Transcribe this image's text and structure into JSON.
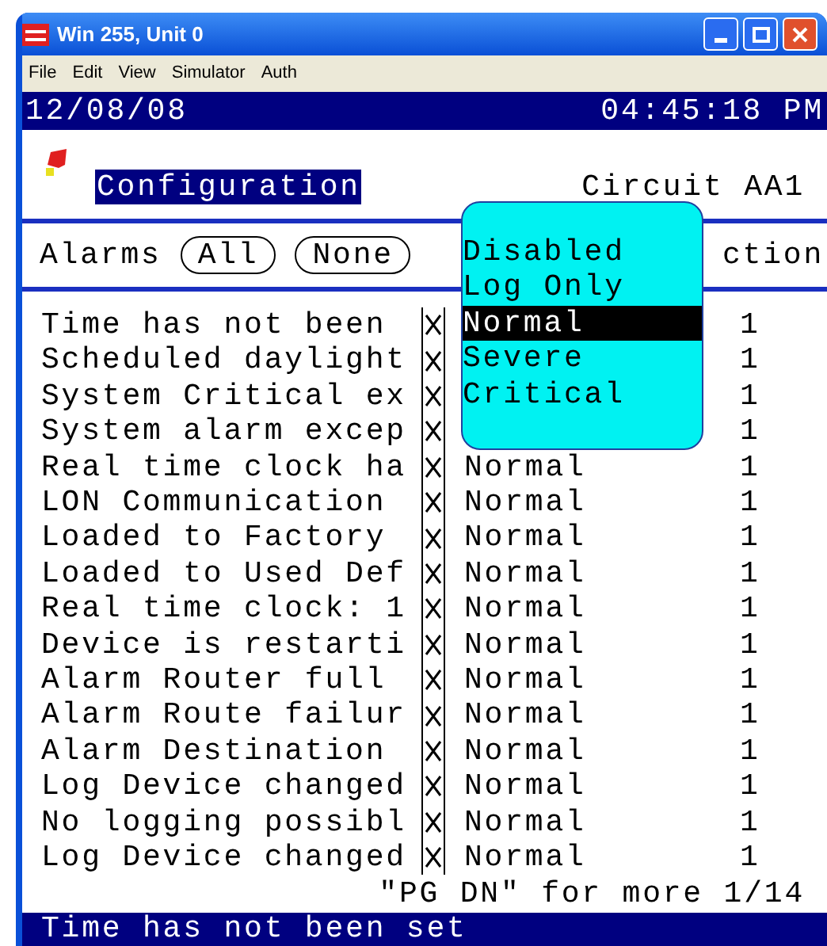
{
  "window": {
    "title": "Win 255, Unit 0"
  },
  "menu": [
    "File",
    "Edit",
    "View",
    "Simulator",
    "Auth"
  ],
  "date_bar": {
    "date": "12/08/08",
    "time": "04:45:18 PM"
  },
  "header": {
    "title": "Configuration",
    "circuit": "Circuit AA1"
  },
  "filter": {
    "label": "Alarms",
    "buttons": [
      "All",
      "None"
    ],
    "column_heading": "ction"
  },
  "rows": [
    {
      "name": "Time has not been",
      "checked": true,
      "severity": "",
      "count": "1"
    },
    {
      "name": "Scheduled daylight",
      "checked": true,
      "severity": "",
      "count": "1"
    },
    {
      "name": "System Critical ex",
      "checked": true,
      "severity": "",
      "count": "1"
    },
    {
      "name": "System alarm excep",
      "checked": true,
      "severity": "",
      "count": "1"
    },
    {
      "name": "Real time clock ha",
      "checked": true,
      "severity": "Normal",
      "count": "1"
    },
    {
      "name": "LON Communication",
      "checked": true,
      "severity": "Normal",
      "count": "1"
    },
    {
      "name": "Loaded to Factory",
      "checked": true,
      "severity": "Normal",
      "count": "1"
    },
    {
      "name": "Loaded to Used Def",
      "checked": true,
      "severity": "Normal",
      "count": "1"
    },
    {
      "name": "Real time clock: 1",
      "checked": true,
      "severity": "Normal",
      "count": "1"
    },
    {
      "name": "Device is restarti",
      "checked": true,
      "severity": "Normal",
      "count": "1"
    },
    {
      "name": "Alarm Router full",
      "checked": true,
      "severity": "Normal",
      "count": "1"
    },
    {
      "name": "Alarm Route failur",
      "checked": true,
      "severity": "Normal",
      "count": "1"
    },
    {
      "name": "Alarm Destination",
      "checked": true,
      "severity": "Normal",
      "count": "1"
    },
    {
      "name": "Log Device changed",
      "checked": true,
      "severity": "Normal",
      "count": "1"
    },
    {
      "name": "No logging possibl",
      "checked": true,
      "severity": "Normal",
      "count": "1"
    },
    {
      "name": "Log Device changed",
      "checked": true,
      "severity": "Normal",
      "count": "1"
    }
  ],
  "page_hint": "\"PG DN\" for more 1/14",
  "dropdown": [
    {
      "label": "Disabled",
      "selected": false
    },
    {
      "label": "Log Only",
      "selected": false
    },
    {
      "label": "Normal",
      "selected": true
    },
    {
      "label": "Severe",
      "selected": false
    },
    {
      "label": "Critical",
      "selected": false
    }
  ],
  "status_bar": "Time has not been set"
}
